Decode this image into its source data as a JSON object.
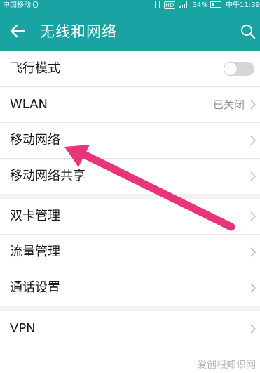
{
  "status_bar": {
    "carrier": "中国移动",
    "network_badge": "HD",
    "battery": "34%",
    "time": "中午11:39"
  },
  "app_bar": {
    "title": "无线和网络",
    "back_icon": "arrow-left-icon",
    "search_icon": "search-icon"
  },
  "groups": [
    {
      "items": [
        {
          "label": "飞行模式",
          "control": "toggle",
          "toggle_on": false
        },
        {
          "label": "WLAN",
          "value": "已关闭",
          "control": "chevron"
        },
        {
          "label": "移动网络",
          "control": "chevron"
        },
        {
          "label": "移动网络共享",
          "control": "chevron"
        }
      ]
    },
    {
      "items": [
        {
          "label": "双卡管理",
          "control": "chevron"
        },
        {
          "label": "流量管理",
          "control": "chevron"
        },
        {
          "label": "通话设置",
          "control": "chevron"
        }
      ]
    },
    {
      "items": [
        {
          "label": "VPN",
          "control": "chevron"
        }
      ]
    }
  ],
  "annotation": {
    "type": "arrow",
    "color": "#e8347a",
    "points_to": "移动网络"
  },
  "watermark": "爱创根知识网",
  "colors": {
    "accent": "#1aa3a3",
    "background": "#f2f2f2",
    "arrow": "#e8347a"
  }
}
